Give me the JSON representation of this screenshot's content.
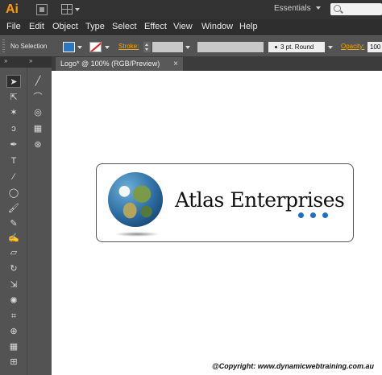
{
  "app": {
    "logo": "Ai",
    "workspace": "Essentials"
  },
  "menu": [
    "File",
    "Edit",
    "Object",
    "Type",
    "Select",
    "Effect",
    "View",
    "Window",
    "Help"
  ],
  "control_bar": {
    "selection": "No Selection",
    "stroke_label": "Stroke:",
    "brush": "3 pt. Round",
    "opacity_label": "Opacity:",
    "opacity_value": "100"
  },
  "document": {
    "tab_title": "Logo* @ 100% (RGB/Preview)",
    "close": "×"
  },
  "logo": {
    "company": "Atlas Enterprises",
    "dot_color": "#1f6fc2"
  },
  "footer": {
    "copyright": "@Copyright: www.dynamicwebtraining.com.au"
  },
  "colors": {
    "fill": "#2a78c2",
    "accent_orange": "#f0a500"
  },
  "icons": {
    "left_column": [
      "selection-tool-icon",
      "direct-selection-tool-icon",
      "magic-wand-icon",
      "lasso-icon",
      "pen-tool-icon",
      "type-tool-icon",
      "line-tool-icon",
      "ellipse-tool-icon",
      "paintbrush-icon",
      "pencil-icon",
      "blob-brush-icon",
      "eraser-icon",
      "rotate-icon",
      "scale-icon",
      "warp-icon",
      "free-transform-icon",
      "shape-builder-icon",
      "perspective-grid-icon",
      "mesh-icon"
    ],
    "right_column": [
      "line-segment-icon",
      "arc-icon",
      "spiral-icon",
      "rectangular-grid-icon",
      "polar-grid-icon"
    ]
  }
}
